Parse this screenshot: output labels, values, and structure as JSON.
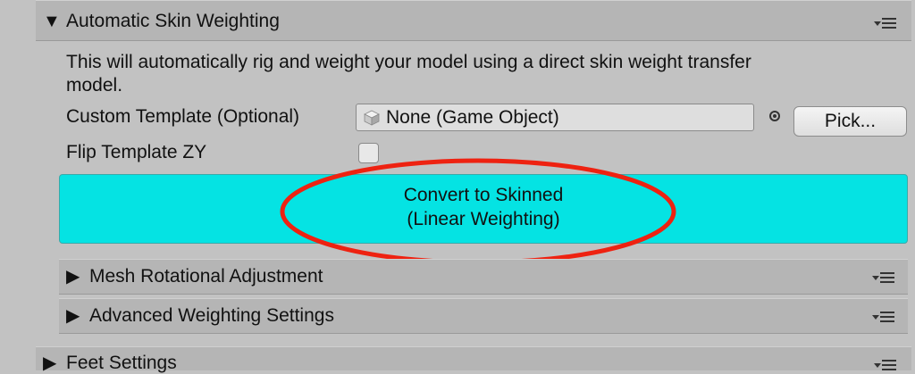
{
  "sections": {
    "automatic_skin_weighting": {
      "title": "Automatic Skin Weighting",
      "expanded_arrow": "▼",
      "description_line1": "This will automatically rig and weight your model using a direct skin weight transfer",
      "description_line2": "model.",
      "custom_template": {
        "label": "Custom Template (Optional)",
        "value": "None (Game Object)",
        "pick_label": "Pick..."
      },
      "flip_template": {
        "label": "Flip Template ZY",
        "checked": false
      },
      "convert_button": {
        "line1": "Convert to Skinned",
        "line2": "(Linear Weighting)"
      }
    },
    "mesh_rotational_adjustment": {
      "title": "Mesh Rotational Adjustment",
      "collapsed_arrow": "▶"
    },
    "advanced_weighting_settings": {
      "title": "Advanced Weighting Settings",
      "collapsed_arrow": "▶"
    },
    "feet_settings": {
      "title": "Feet Settings",
      "collapsed_arrow": "▶"
    }
  },
  "icons": {
    "foldout_menu": "dropdown-menu-icon",
    "object_field": "cube-icon",
    "object_picker": "target-icon"
  },
  "colors": {
    "background": "#c2c2c2",
    "foldout_header": "#b5b5b5",
    "convert_button": "#05e3e3",
    "annotation_ellipse": "#ee2211"
  }
}
